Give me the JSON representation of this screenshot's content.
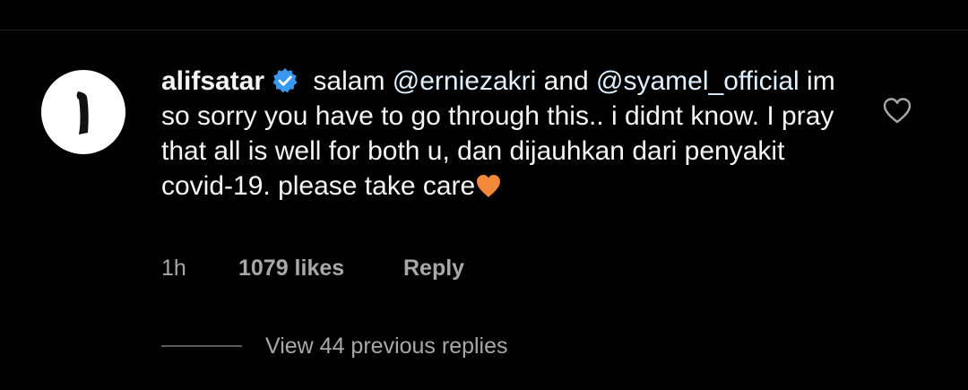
{
  "comment": {
    "username": "alifsatar",
    "verified": true,
    "text_parts": {
      "p1": " salam ",
      "mention1": "@erniezakri",
      "p2": " and ",
      "mention2": "@syamel_official",
      "p3": " im so sorry you have to go through this.. i didnt know. I pray that all is well for both u, dan dijauhkan dari penyakit covid-19. please take care"
    },
    "emoji": "orange-heart",
    "time": "1h",
    "likes": "1079 likes",
    "reply_label": "Reply"
  },
  "replies": {
    "view_label": "View 44 previous replies"
  },
  "colors": {
    "background": "#000000",
    "text": "#f5f5f5",
    "mention": "#e0f1ff",
    "secondary": "#a8a8a8",
    "verified_blue": "#3897f0",
    "orange_heart": "#f4883a"
  },
  "icons": {
    "verified": "verified-badge-icon",
    "like": "heart-outline-icon",
    "emoji": "orange-heart-icon"
  }
}
